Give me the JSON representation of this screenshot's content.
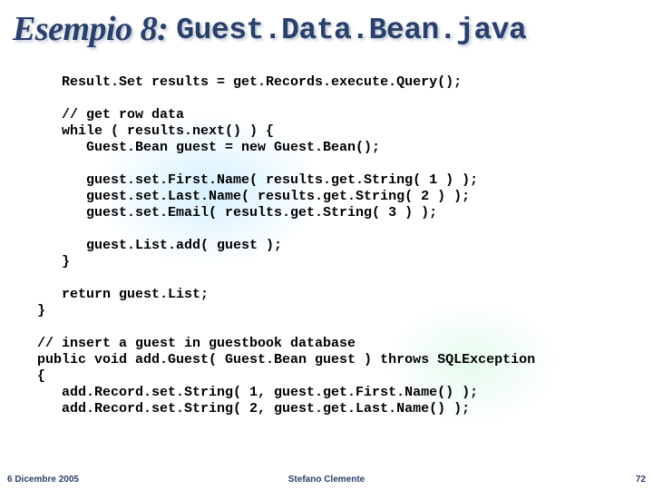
{
  "title": {
    "prefix": "Esempio 8: ",
    "filename": "Guest.Data.Bean.java"
  },
  "code": {
    "lines": [
      "    Result.Set results = get.Records.execute.Query();",
      "",
      "    // get row data",
      "    while ( results.next() ) {",
      "       Guest.Bean guest = new Guest.Bean();",
      "",
      "       guest.set.First.Name( results.get.String( 1 ) );",
      "       guest.set.Last.Name( results.get.String( 2 ) );",
      "       guest.set.Email( results.get.String( 3 ) );",
      "",
      "       guest.List.add( guest );",
      "    }",
      "",
      "    return guest.List;",
      " }",
      "",
      " // insert a guest in guestbook database",
      " public void add.Guest( Guest.Bean guest ) throws SQLException",
      " {",
      "    add.Record.set.String( 1, guest.get.First.Name() );",
      "    add.Record.set.String( 2, guest.get.Last.Name() );"
    ]
  },
  "footer": {
    "date": "6 Dicembre 2005",
    "author": "Stefano Clemente",
    "page": "72"
  }
}
